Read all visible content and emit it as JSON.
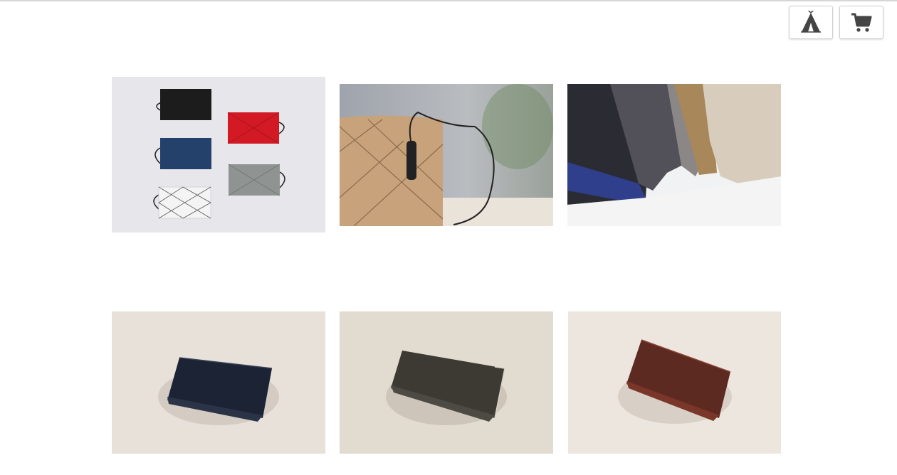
{
  "header": {
    "buttons": [
      {
        "name": "tent-button",
        "icon": "tent-icon"
      },
      {
        "name": "cart-button",
        "icon": "cart-icon"
      }
    ]
  },
  "colors": {
    "icon": "#444444",
    "border": "#cfcfcf"
  },
  "products": [
    {
      "name": "product-image-wallets-set",
      "description_icon": "colored-fabric-wallets"
    },
    {
      "name": "product-image-pouch",
      "description_icon": "tan-pouch-with-cord"
    },
    {
      "name": "product-image-caps",
      "description_icon": "folded-caps"
    },
    {
      "name": "product-image-wallet-navy",
      "description_icon": "navy-leather-wallet"
    },
    {
      "name": "product-image-wallet-olive",
      "description_icon": "olive-leather-wallet"
    },
    {
      "name": "product-image-wallet-brown",
      "description_icon": "brown-leather-wallet"
    }
  ]
}
